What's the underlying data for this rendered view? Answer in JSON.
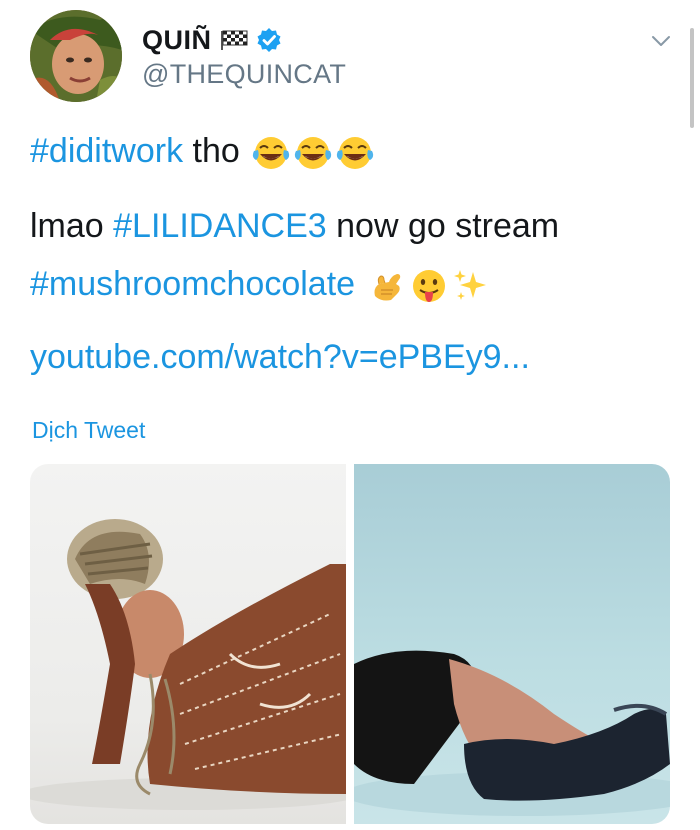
{
  "user": {
    "display_name": "QUIÑ",
    "handle": "@THEQUINCAT",
    "verified": true,
    "avatar_icon": "avatar-photo"
  },
  "icons": {
    "flag": "checkered-flag-icon",
    "verified": "verified-badge-icon",
    "menu": "chevron-down-icon"
  },
  "tweet": {
    "line1": {
      "hashtag": "#diditwork",
      "text": " tho",
      "emojis": [
        "tears-of-joy-emoji",
        "tears-of-joy-emoji",
        "tears-of-joy-emoji"
      ]
    },
    "line2": {
      "prefix": "lmao ",
      "hashtag": "#LILIDANCE3",
      "suffix": " now go stream"
    },
    "line3": {
      "hashtag": "#mushroomchocolate",
      "emojis": [
        "call-me-hand-emoji",
        "tongue-out-emoji",
        "sparkles-emoji"
      ]
    },
    "link": "youtube.com/watch?v=ePBEy9..."
  },
  "translate_label": "Dịch Tweet",
  "colors": {
    "link": "#1b95e0",
    "secondary_text": "#657786",
    "primary_text": "#14171a",
    "verified": "#1da1f2"
  },
  "media": [
    {
      "name": "media-photo-1"
    },
    {
      "name": "media-photo-2"
    }
  ]
}
